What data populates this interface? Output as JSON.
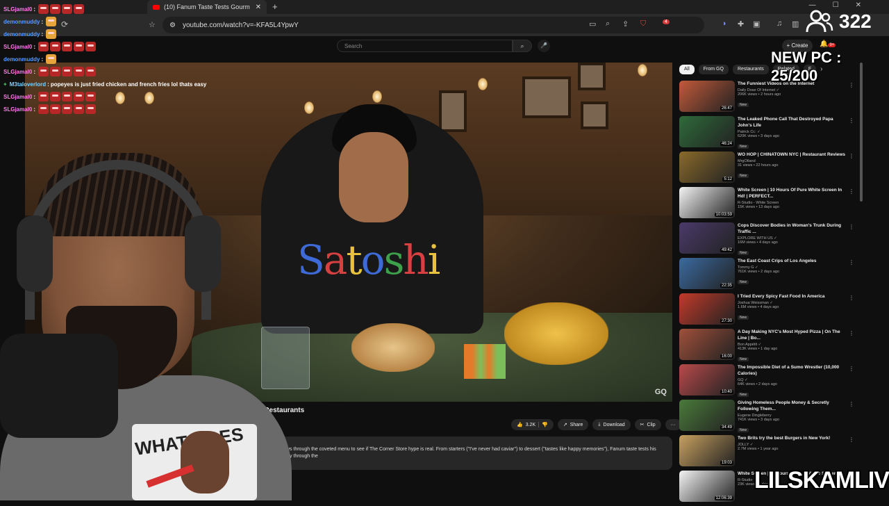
{
  "browser": {
    "tab_title": "(10) Fanum Taste Tests Gourm",
    "tab_close": "✕",
    "new_tab": "+",
    "url": "youtube.com/watch?v=-KFA5L4YpwY",
    "window_controls": [
      "—",
      "☐",
      "✕"
    ],
    "adblock_badge": "4"
  },
  "youtube": {
    "search_placeholder": "Search",
    "create_label": "Create",
    "notif_badge": "9+",
    "video_title_partial": "e Restaurants",
    "watermark": "GQ",
    "actions": {
      "like": "3.2K",
      "share": "Share",
      "download": "Download",
      "clip": "Clip",
      "more": "···"
    },
    "description": "ows through the coveted menu to see if The Corner Store hype is real. From starters (\"I've never had caviar\") to dessert (\"tastes like happy memories\"), Fanum taste tests his way through the",
    "chips": [
      "All",
      "From GQ",
      "Restaurants",
      "Related",
      "F"
    ],
    "recommendations": [
      {
        "title": "The Funniest Videos on the Internet",
        "channel": "Daily Dose Of Internet ✓",
        "views": "206K views • 2 hours ago",
        "duration": "26:47",
        "badge": "New",
        "color": "#c25a3a"
      },
      {
        "title": "The Leaked Phone Call That Destroyed Papa John's Life",
        "channel": "Patrick Cc: ✓",
        "views": "620K views • 3 days ago",
        "duration": "46:24",
        "badge": "New",
        "color": "#2f6b3a"
      },
      {
        "title": "WO HOP | CHINATOWN NYC | Restaurant Reviews",
        "channel": "MrgOtland",
        "views": "31 views • 22 hours ago",
        "duration": "5:12",
        "badge": "New",
        "color": "#8a6a2a"
      },
      {
        "title": "White Screen | 10 Hours Of Pure White Screen In Hd! | PERFECT...",
        "channel": "R-Studio - White Screen",
        "views": "15K views • 13 days ago",
        "duration": "10:03:59",
        "badge": "",
        "color": "#f4f4f4"
      },
      {
        "title": "Cops Discover Bodies in Woman's Trunk During Traffic ...",
        "channel": "EXPLORE WITH US ✓",
        "views": "16M views • 4 days ago",
        "duration": "49:42",
        "badge": "New",
        "color": "#4a3a6a"
      },
      {
        "title": "The East Coast Crips of Los Angeles",
        "channel": "Tommy G ✓",
        "views": "761K views • 2 days ago",
        "duration": "22:35",
        "badge": "New",
        "color": "#3a6aa0"
      },
      {
        "title": "I Tried Every Spicy Fast Food In America",
        "channel": "Joshua Weissman ✓",
        "views": "1.6M views • 4 days ago",
        "duration": "27:30",
        "badge": "New",
        "color": "#c23a2a"
      },
      {
        "title": "A Day Making NYC's Most Hyped Pizza | On The Line | Bo...",
        "channel": "Bon Appétit ✓",
        "views": "413K views • 1 day ago",
        "duration": "16:00",
        "badge": "New",
        "color": "#a0503a"
      },
      {
        "title": "The Impossible Diet of a Sumo Wrestler (10,000 Calories)",
        "channel": "GQ ✓",
        "views": "64K views • 2 days ago",
        "duration": "10:40",
        "badge": "New",
        "color": "#b84a4a"
      },
      {
        "title": "Giving Homeless People Money & Secretly Following Them...",
        "channel": "Eugene Dingleberry",
        "views": "741K views • 3 days ago",
        "duration": "34:49",
        "badge": "New",
        "color": "#4a7a3a"
      },
      {
        "title": "Two Brits try the best Burgers in New York!",
        "channel": "JOLLY ✓",
        "views": "2.7M views • 1 year ago",
        "duration": "19:03",
        "badge": "",
        "color": "#c8a060"
      },
      {
        "title": "White Screen | 10 Hours Of Pure White Screen...",
        "channel": "R-Studio",
        "views": "23K views • 4 days ago",
        "duration": "12:06:39",
        "badge": "",
        "color": "#f4f4f4"
      }
    ]
  },
  "chat": [
    {
      "user": "SLGjamal0",
      "text": "",
      "emotes": 4,
      "x": false,
      "cls": "pink"
    },
    {
      "user": "demonmuddy",
      "text": "",
      "emotes": 0,
      "x": true,
      "cls": ""
    },
    {
      "user": "demonmuddy",
      "text": "",
      "emotes": 0,
      "x": true,
      "cls": ""
    },
    {
      "user": "SLGjamal0",
      "text": "",
      "emotes": 5,
      "x": false,
      "cls": "pink"
    },
    {
      "user": "demonmuddy",
      "text": "",
      "emotes": 0,
      "x": true,
      "cls": ""
    },
    {
      "user": "SLGjamal0",
      "text": "",
      "emotes": 5,
      "x": false,
      "cls": "pink"
    },
    {
      "user": "M3taloverlord",
      "text": "popeyes is just fried chicken and french fries lol thats easy",
      "emotes": 0,
      "x": false,
      "cls": "alt"
    },
    {
      "user": "SLGjamal0",
      "text": "",
      "emotes": 5,
      "x": false,
      "cls": "pink"
    },
    {
      "user": "SLGjamal0",
      "text": "",
      "emotes": 5,
      "x": false,
      "cls": "pink"
    }
  ],
  "overlay": {
    "viewer_count": "322",
    "goal": "NEW PC : 25/200",
    "brand": "LILSKAMLIVE",
    "shirt_word": "Satoshi",
    "cam_shirt_text": "WHAT DOES"
  }
}
